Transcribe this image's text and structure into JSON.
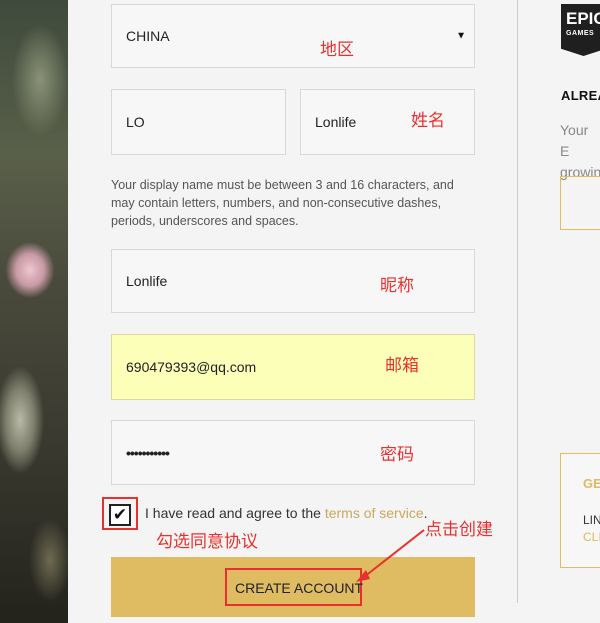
{
  "form": {
    "country": {
      "value": "CHINA",
      "annotation": "地区"
    },
    "first_name": {
      "value": "LO"
    },
    "last_name": {
      "value": "Lonlife",
      "annotation": "姓名"
    },
    "display_name_note": "Your display name must be between 3 and 16 characters, and may contain letters, numbers, and non-consecutive dashes, periods, underscores and spaces.",
    "display_name": {
      "value": "Lonlife",
      "annotation": "昵称"
    },
    "email": {
      "value": "690479393@qq.com",
      "annotation": "邮箱"
    },
    "password": {
      "value": "•••••••••••",
      "annotation": "密码"
    },
    "agree": {
      "checked": true,
      "text": "I have read and agree to the ",
      "link": "terms of service",
      "suffix": ".",
      "annotation": "勾选同意协议"
    },
    "create_button": {
      "label": "CREATE ACCOUNT",
      "annotation": "点击创建"
    }
  },
  "right_panel": {
    "logo": {
      "line1": "EPIC",
      "line2": "GAMES"
    },
    "title": "ALREA",
    "text_line1": "Your E",
    "text_line2": "growin",
    "card": {
      "heading": "GE",
      "line1": "LIN",
      "line2": "CLI"
    }
  },
  "colors": {
    "accent_gold": "#dfbb62",
    "annotation_red": "#e8312f",
    "autofill_yellow": "#fbffb8"
  }
}
